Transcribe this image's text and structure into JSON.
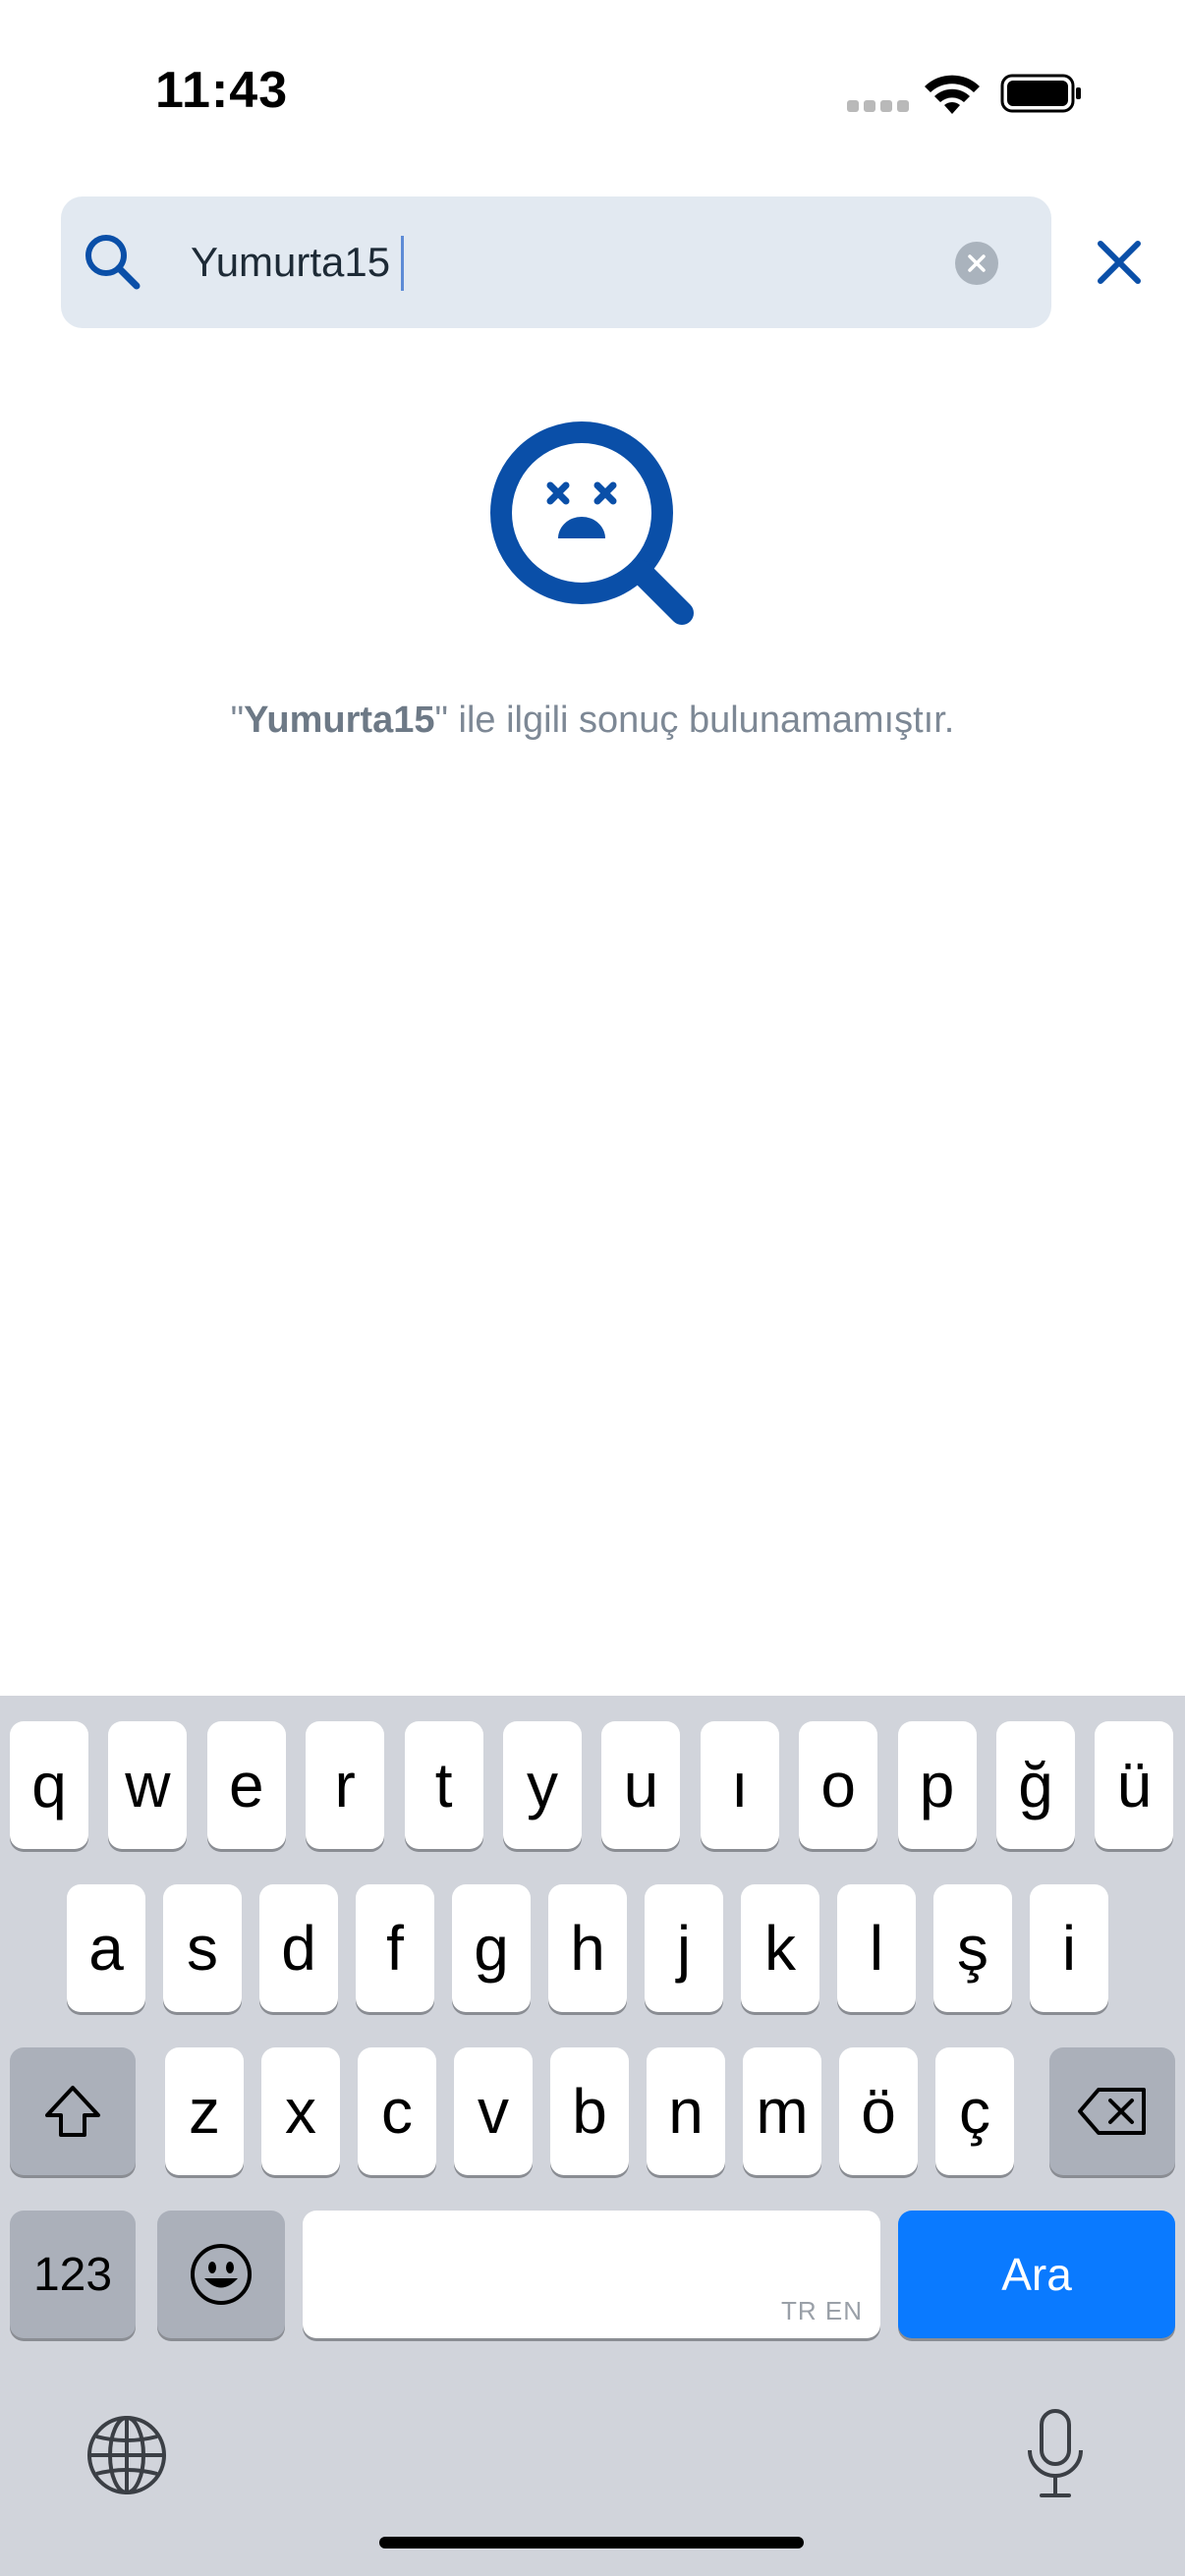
{
  "status_bar": {
    "time": "11:43"
  },
  "search": {
    "query": "Yumurta15"
  },
  "empty_state": {
    "quote_open": "\"",
    "query": "Yumurta15",
    "message_suffix": "\" ile ilgili sonuç bulunamamıştır."
  },
  "colors": {
    "accent": "#0a4fa8",
    "search_bg": "#e2e9f1",
    "keyboard_bg": "#d1d4db",
    "action_key": "#0a7aff"
  },
  "keyboard": {
    "row1": [
      "q",
      "w",
      "e",
      "r",
      "t",
      "y",
      "u",
      "ı",
      "o",
      "p",
      "ğ",
      "ü"
    ],
    "row2": [
      "a",
      "s",
      "d",
      "f",
      "g",
      "h",
      "j",
      "k",
      "l",
      "ş",
      "i"
    ],
    "row3": [
      "z",
      "x",
      "c",
      "v",
      "b",
      "n",
      "m",
      "ö",
      "ç"
    ],
    "numbers_label": "123",
    "space_lang_hint": "TR EN",
    "action_label": "Ara",
    "icons": [
      "shift-icon",
      "backspace-icon",
      "emoji-icon",
      "globe-icon",
      "microphone-icon"
    ]
  }
}
